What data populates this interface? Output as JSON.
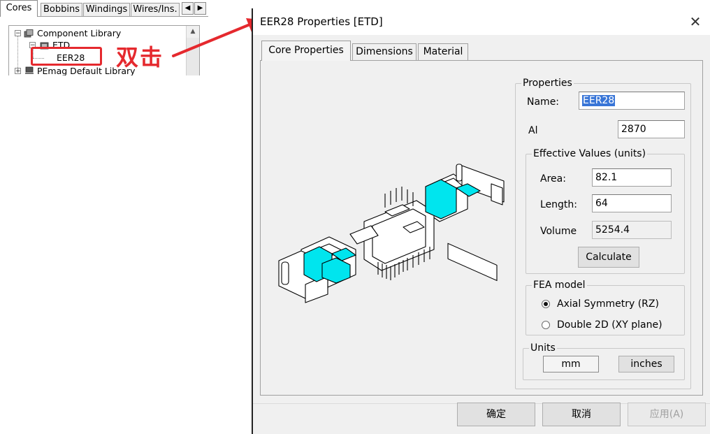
{
  "left_panel": {
    "tabs": [
      "Cores",
      "Bobbins",
      "Windings",
      "Wires/Ins."
    ],
    "tree": {
      "root": "Component Library",
      "folder": "ETD",
      "selected_item": "EER28",
      "second_root": "PEmag Default Library"
    }
  },
  "annotation": {
    "text": "双击",
    "color": "#e5292e"
  },
  "dialog": {
    "title": "EER28 Properties [ETD]",
    "tabs": [
      "Core Properties",
      "Dimensions",
      "Material"
    ],
    "active_tab": "Core Properties",
    "properties": {
      "group_label": "Properties",
      "name_label": "Name:",
      "name_value": "EER28",
      "al_label": "Al",
      "al_value": "2870"
    },
    "effective_values": {
      "group_label": "Effective Values (units)",
      "area_label": "Area:",
      "area_value": "82.1",
      "length_label": "Length:",
      "length_value": "64",
      "volume_label": "Volume",
      "volume_value": "5254.4",
      "calculate_label": "Calculate"
    },
    "fea_model": {
      "group_label": "FEA model",
      "options": [
        "Axial Symmetry (RZ)",
        "Double 2D (XY plane)"
      ],
      "selected": "Axial Symmetry (RZ)"
    },
    "units": {
      "group_label": "Units",
      "options": [
        "mm",
        "inches"
      ],
      "selected": "mm"
    },
    "footer_buttons": {
      "ok": "确定",
      "cancel": "取消",
      "apply": "应用(A)"
    },
    "highlight_color": "#00e5ee"
  }
}
